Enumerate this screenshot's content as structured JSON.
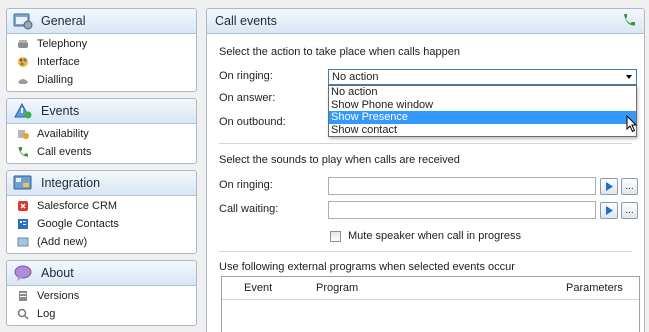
{
  "sidebar": {
    "groups": [
      {
        "title": "General",
        "icon": "settings-window-icon",
        "items": [
          {
            "label": "Telephony",
            "icon": "phone-icon"
          },
          {
            "label": "Interface",
            "icon": "palette-icon"
          },
          {
            "label": "Dialling",
            "icon": "dialling-icon"
          }
        ]
      },
      {
        "title": "Events",
        "icon": "events-icon",
        "items": [
          {
            "label": "Availability",
            "icon": "availability-icon"
          },
          {
            "label": "Call events",
            "icon": "call-events-icon"
          }
        ]
      },
      {
        "title": "Integration",
        "icon": "integration-icon",
        "items": [
          {
            "label": "Salesforce CRM",
            "icon": "salesforce-icon"
          },
          {
            "label": "Google Contacts",
            "icon": "contacts-icon"
          },
          {
            "label": "(Add new)",
            "icon": "add-new-icon"
          }
        ]
      },
      {
        "title": "About",
        "icon": "speech-bubble-icon",
        "items": [
          {
            "label": "Versions",
            "icon": "versions-icon"
          },
          {
            "label": "Log",
            "icon": "log-icon"
          }
        ]
      }
    ]
  },
  "panel": {
    "title": "Call events",
    "header_icon": "phone-handset-icon",
    "actions_title": "Select the action to take place when calls happen",
    "on_ringing_label": "On ringing:",
    "on_answer_label": "On answer:",
    "on_outbound_label": "On outbound:",
    "on_ringing_value": "No action",
    "dropdown_options": [
      "No action",
      "Show Phone window",
      "Show Presence",
      "Show contact"
    ],
    "dropdown_highlighted": "Show Presence",
    "sounds_title": "Select the sounds to play when calls are received",
    "sound_ringing_label": "On ringing:",
    "sound_waiting_label": "Call waiting:",
    "sound_ringing_value": "",
    "sound_waiting_value": "",
    "browse_label": "...",
    "mute_label": "Mute speaker when call in progress",
    "external_title": "Use following external programs when selected events occur",
    "columns": [
      "Event",
      "Program",
      "Parameters"
    ]
  },
  "colors": {
    "header_gradient_top": "#f4f8fc",
    "header_gradient_bottom": "#d9e6f4",
    "selection": "#3399ff",
    "play_icon": "#1f6fd1"
  }
}
